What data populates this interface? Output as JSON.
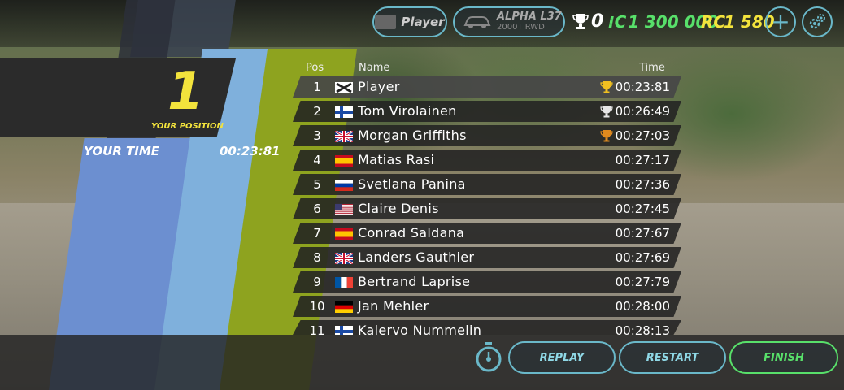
{
  "hud": {
    "player_label": "Player",
    "car_name": "ALPHA L37",
    "car_spec": "2000T RWD",
    "trophies": "0",
    "credits": "1 300 000",
    "rc_label": "RC",
    "rc_value": "1 580",
    "credit_icon": "credit-icon",
    "colors": {
      "accent": "#6ab8c9",
      "credits": "#58e06a",
      "rc": "#f3e33c"
    }
  },
  "position_card": {
    "position": "1",
    "position_label": "YOUR POSITION",
    "time_label": "YOUR TIME",
    "time_value": "00:23:81"
  },
  "table": {
    "headers": {
      "pos": "Pos",
      "name": "Name",
      "time": "Time"
    },
    "rows": [
      {
        "pos": "1",
        "flag": "player",
        "name": "Player",
        "time": "00:23:81",
        "trophy": "gold"
      },
      {
        "pos": "2",
        "flag": "finland",
        "name": "Tom Virolainen",
        "time": "00:26:49",
        "trophy": "silver"
      },
      {
        "pos": "3",
        "flag": "uk",
        "name": "Morgan Griffiths",
        "time": "00:27:03",
        "trophy": "bronze"
      },
      {
        "pos": "4",
        "flag": "spain",
        "name": "Matias Rasi",
        "time": "00:27:17",
        "trophy": ""
      },
      {
        "pos": "5",
        "flag": "russia",
        "name": "Svetlana Panina",
        "time": "00:27:36",
        "trophy": ""
      },
      {
        "pos": "6",
        "flag": "usa",
        "name": "Claire Denis",
        "time": "00:27:45",
        "trophy": ""
      },
      {
        "pos": "7",
        "flag": "spain",
        "name": "Conrad Saldana",
        "time": "00:27:67",
        "trophy": ""
      },
      {
        "pos": "8",
        "flag": "uk",
        "name": "Landers Gauthier",
        "time": "00:27:69",
        "trophy": ""
      },
      {
        "pos": "9",
        "flag": "france",
        "name": "Bertrand Laprise",
        "time": "00:27:79",
        "trophy": ""
      },
      {
        "pos": "10",
        "flag": "germany",
        "name": "Jan Mehler",
        "time": "00:28:00",
        "trophy": ""
      },
      {
        "pos": "11",
        "flag": "finland",
        "name": "Kalervo Nummelin",
        "time": "00:28:13",
        "trophy": ""
      }
    ]
  },
  "buttons": {
    "replay": "REPLAY",
    "restart": "RESTART",
    "finish": "FINISH"
  }
}
